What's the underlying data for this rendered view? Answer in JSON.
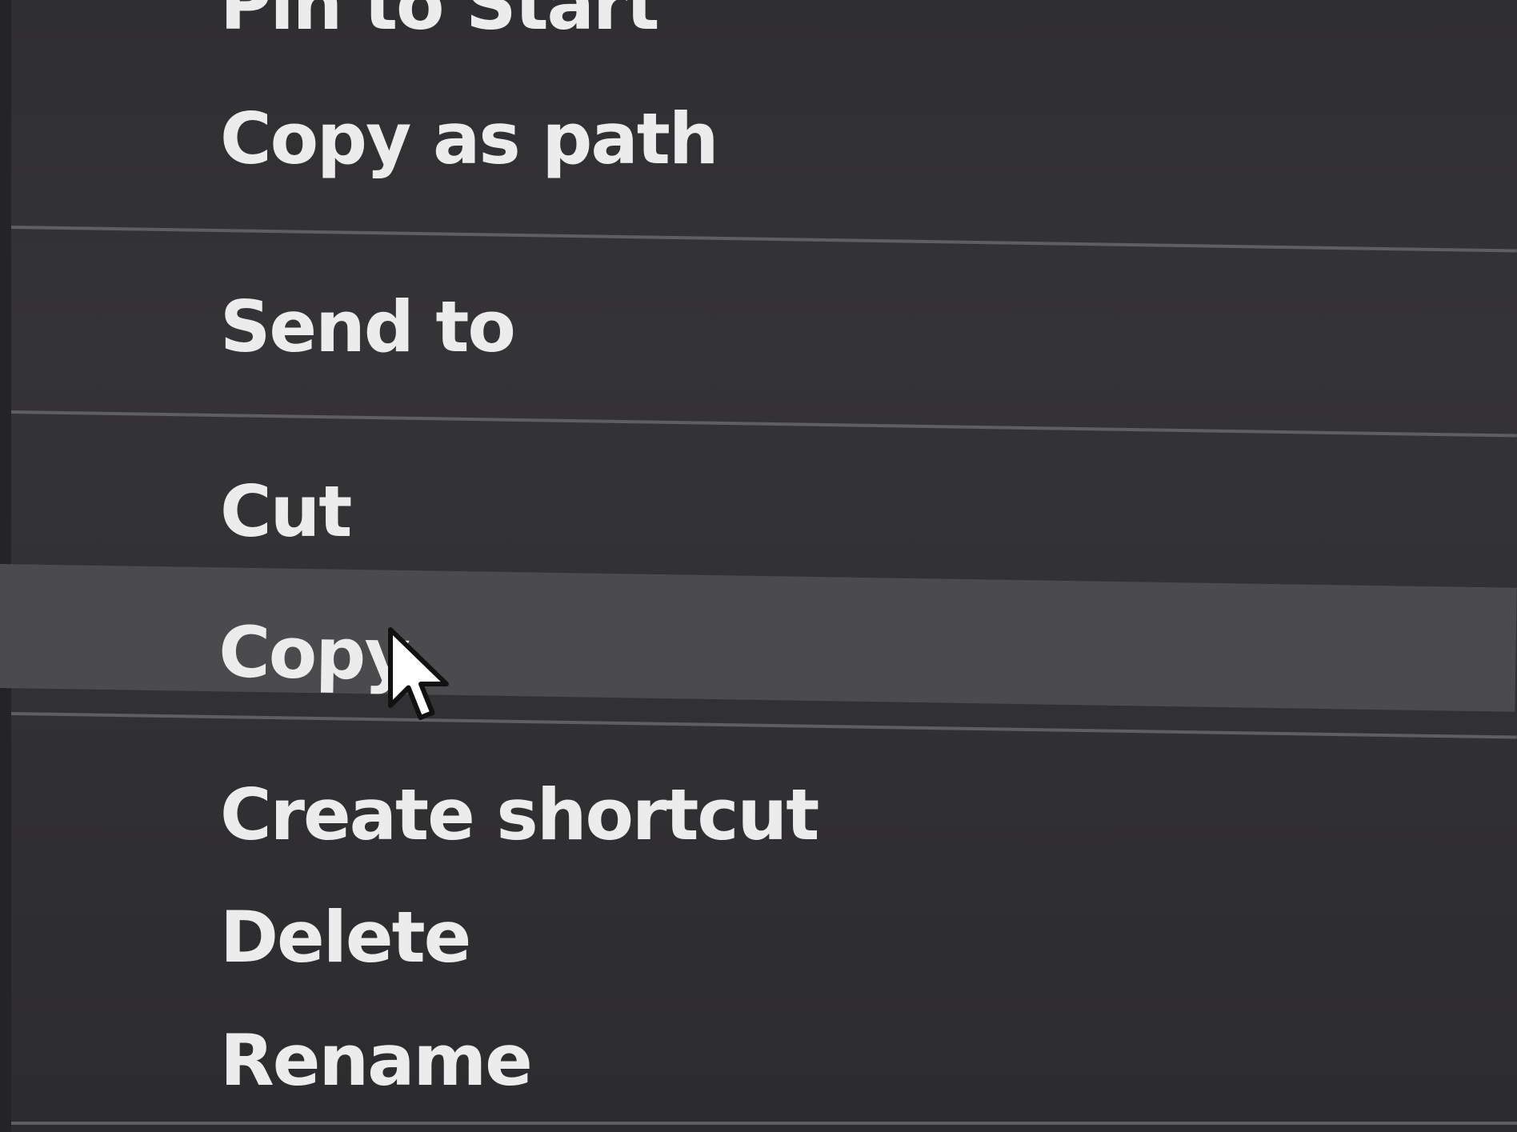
{
  "context_menu": {
    "items": [
      {
        "label": "Pin to Start"
      },
      {
        "label": "Copy as path"
      },
      {
        "label": "Send to"
      },
      {
        "label": "Cut"
      },
      {
        "label": "Copy",
        "state": "hovered"
      },
      {
        "label": "Create shortcut"
      },
      {
        "label": "Delete"
      },
      {
        "label": "Rename"
      }
    ]
  },
  "cursor": {
    "icon": "arrow-pointer-icon"
  },
  "colors": {
    "menu_background": "#333234",
    "hover_background": "#4b4a4d",
    "text": "#ececec",
    "separator": "#5f5e61"
  }
}
